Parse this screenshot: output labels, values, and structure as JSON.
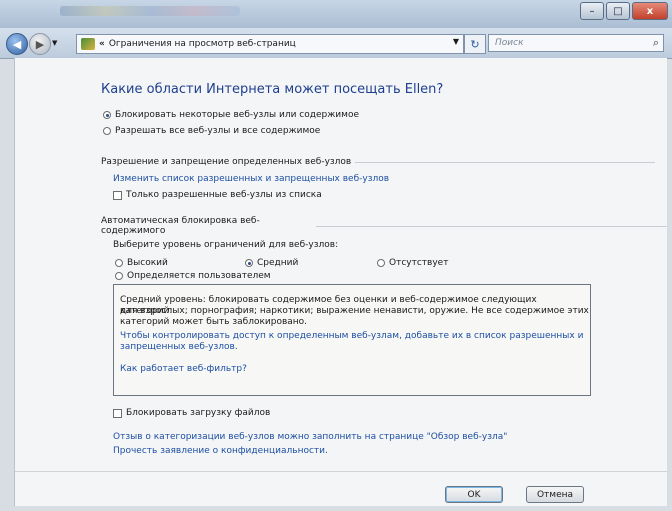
{
  "window": {
    "buttons": {
      "min": "–",
      "max": "□",
      "close": "x"
    }
  },
  "nav": {
    "back": "◀",
    "forward": "▶",
    "address": "Ограничения на просмотр веб-страниц",
    "breadcrumb_chevron": "«",
    "dropdown": "▼",
    "refresh": "↻",
    "search_placeholder": "Поиск",
    "search_icon": "⌕"
  },
  "page": {
    "heading": "Какие области Интернета может посещать Ellen?",
    "mode_options": [
      {
        "label": "Блокировать некоторые веб-узлы или содержимое",
        "selected": true
      },
      {
        "label": "Разрешать все веб-узлы и все содержимое",
        "selected": false
      }
    ],
    "allow_block_section": {
      "title": "Разрешение и запрещение определенных веб-узлов",
      "edit_link": "Изменить список разрешенных и  запрещенных веб-узлов",
      "only_allowed_label": "Только разрешенные веб-узлы из списка",
      "only_allowed_checked": false
    },
    "auto_block_section": {
      "title": "Автоматическая блокировка веб-содержимого",
      "level_prompt": "Выберите уровень ограничений для веб-узлов:",
      "levels": [
        {
          "label": "Высокий",
          "selected": false
        },
        {
          "label": "Средний",
          "selected": true
        },
        {
          "label": "Отсутствует",
          "selected": false
        },
        {
          "label": "Определяется пользователем",
          "selected": false
        }
      ],
      "info": {
        "line1": "Средний уровень: блокировать содержимое без оценки и веб-содержимое следующих категорий:",
        "line2": "для взрослых; порнография; наркотики; выражение ненависти, оружие. Не все содержимое этих",
        "line3": "категорий может быть заблокировано.",
        "link1_line1": "Чтобы контролировать доступ к определенным веб-узлам, добавьте их в список разрешенных и",
        "link1_line2": "запрещенных веб-узлов.",
        "link2": "Как работает веб-фильтр?"
      },
      "block_downloads_label": "Блокировать загрузку файлов",
      "block_downloads_checked": false
    },
    "footer_links": {
      "review": "Отзыв о категоризации веб-узлов можно заполнить на странице \"Обзор веб-узла\"",
      "privacy": "Прочесть заявление о конфиденциальности."
    },
    "buttons": {
      "ok": "OK",
      "cancel": "Отмена"
    }
  },
  "colors": {
    "link": "#1d4fa3",
    "heading": "#1e3f8f",
    "page_bg": "#f4f5f6"
  }
}
